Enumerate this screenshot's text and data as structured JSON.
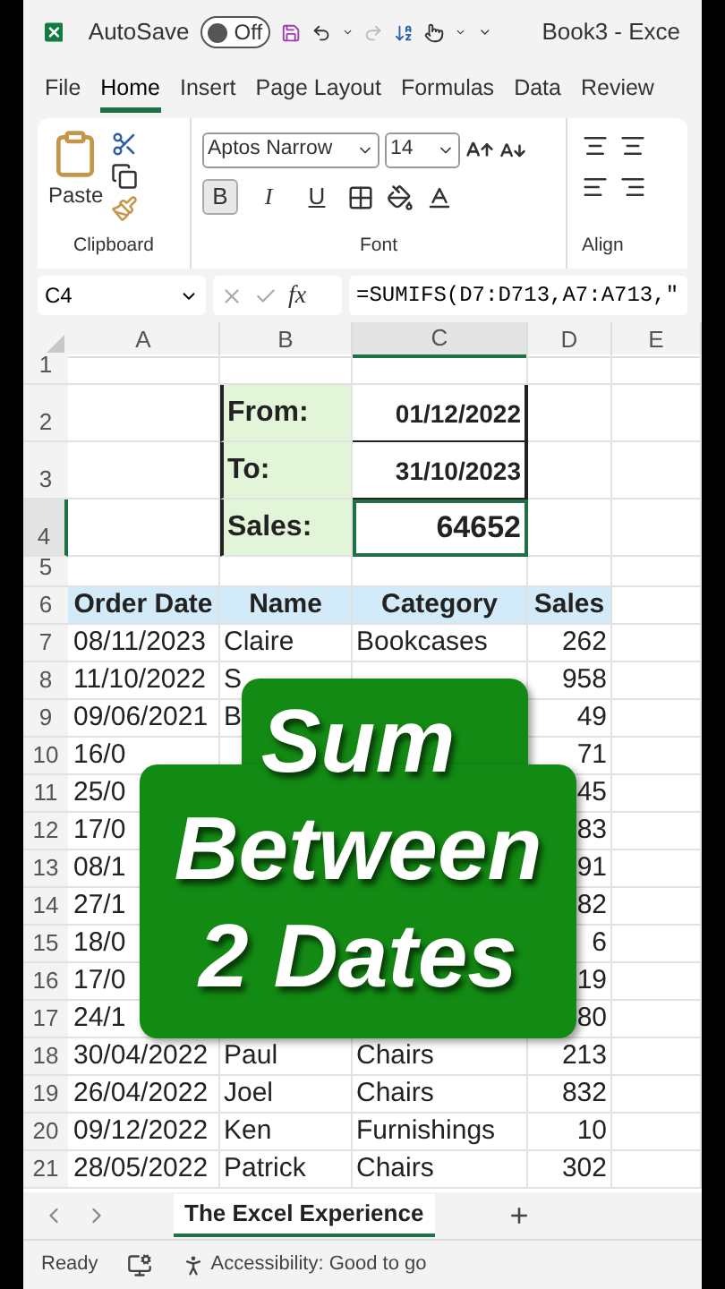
{
  "title_bar": {
    "autosave_label": "AutoSave",
    "autosave": {
      "label": "Off",
      "on": false
    },
    "redo_disabled": true,
    "title": "Book3 - Exce"
  },
  "menu_tabs": [
    {
      "label": "File",
      "selected": false
    },
    {
      "label": "Home",
      "selected": true
    },
    {
      "label": "Insert",
      "selected": false
    },
    {
      "label": "Page Layout",
      "selected": false
    },
    {
      "label": "Formulas",
      "selected": false
    },
    {
      "label": "Data",
      "selected": false
    },
    {
      "label": "Review",
      "selected": false
    }
  ],
  "ribbon": {
    "paste_label": "Paste",
    "clipboard_label": "Clipboard",
    "font_name": "Aptos Narrow",
    "font_size": "14",
    "format_buttons": [
      {
        "label": "B",
        "selected": true
      },
      {
        "label": "I",
        "selected": false
      },
      {
        "label": "U",
        "selected": false
      }
    ],
    "font_label": "Font",
    "alignment_label": "Align"
  },
  "formula_bar": {
    "name_box": "C4",
    "fx": "fx",
    "formula": "=SUMIFS(D7:D713,A7:A713,\""
  },
  "columns": [
    {
      "label": "A",
      "selected": false
    },
    {
      "label": "B",
      "selected": false
    },
    {
      "label": "C",
      "selected": true
    },
    {
      "label": "D",
      "selected": false
    },
    {
      "label": "E",
      "selected": false
    }
  ],
  "empty_rows": [
    "1",
    "5"
  ],
  "criteria": [
    {
      "row": "2",
      "label": "From:",
      "value": "01/12/2022",
      "selected": false
    },
    {
      "row": "3",
      "label": "To:",
      "value": "31/10/2023",
      "selected": false
    },
    {
      "row": "4",
      "label": "Sales:",
      "value": "64652",
      "selected": true
    }
  ],
  "headers": {
    "row": "6",
    "order_date": "Order Date",
    "name": "Name",
    "category": "Category",
    "sales": "Sales"
  },
  "rows": [
    {
      "row": "7",
      "order_date": "08/11/2023",
      "name": "Claire",
      "category": "Bookcases",
      "sales": "262"
    },
    {
      "row": "8",
      "order_date": "11/10/2022",
      "name": "S",
      "sales": "958"
    },
    {
      "row": "9",
      "order_date": "09/06/2021",
      "name": "B",
      "sales": "49"
    },
    {
      "row": "10",
      "order_date": "16/0",
      "sales": "71"
    },
    {
      "row": "11",
      "order_date": "25/0",
      "sales": "45"
    },
    {
      "row": "12",
      "order_date": "17/0",
      "sales": "83"
    },
    {
      "row": "13",
      "order_date": "08/1",
      "sales": "91"
    },
    {
      "row": "14",
      "order_date": "27/1",
      "sales": "82"
    },
    {
      "row": "15",
      "order_date": "18/0",
      "sales": "6"
    },
    {
      "row": "16",
      "order_date": "17/0",
      "sales": "19"
    },
    {
      "row": "17",
      "order_date": "24/1",
      "sales": "80"
    },
    {
      "row": "18",
      "order_date": "30/04/2022",
      "name": "Paul",
      "category": "Chairs",
      "sales": "213"
    },
    {
      "row": "19",
      "order_date": "26/04/2022",
      "name": "Joel",
      "category": "Chairs",
      "sales": "832"
    },
    {
      "row": "20",
      "order_date": "09/12/2022",
      "name": "Ken",
      "category": "Furnishings",
      "sales": "10"
    },
    {
      "row": "21",
      "order_date": "28/05/2022",
      "name": "Patrick",
      "category": "Chairs",
      "sales": "302"
    }
  ],
  "overlay": {
    "lines": [
      "Sum",
      "Between",
      "2 Dates"
    ]
  },
  "sheet_tabs": [
    {
      "label": "The Excel Experience",
      "selected": true
    }
  ],
  "new_sheet": "+",
  "status_bar": {
    "ready": "Ready",
    "accessibility": "Accessibility: Good to go"
  }
}
